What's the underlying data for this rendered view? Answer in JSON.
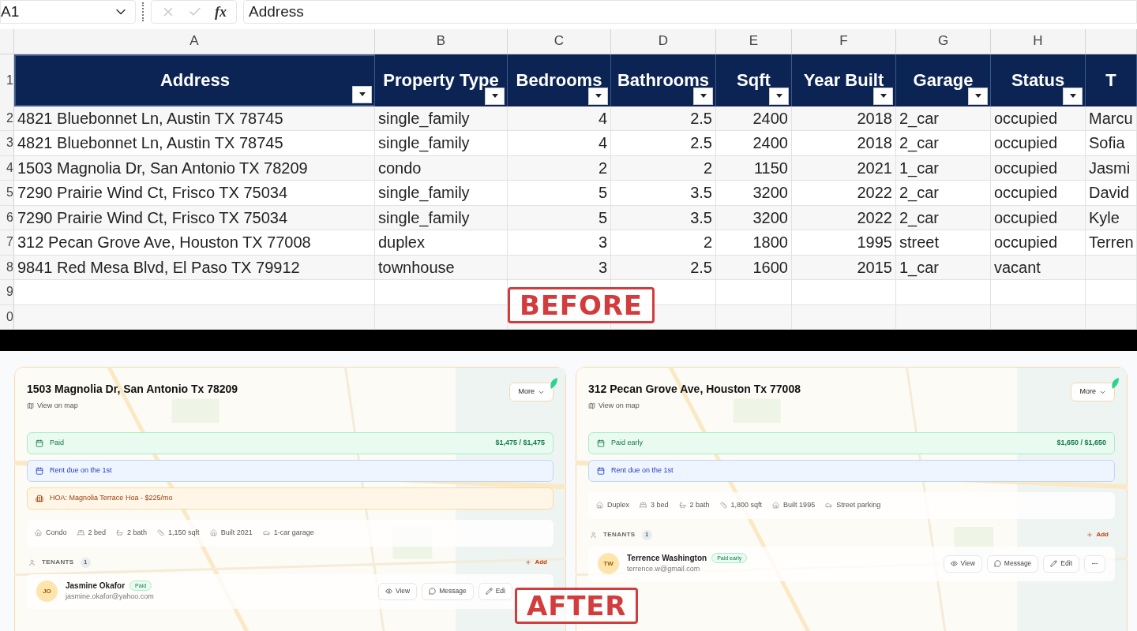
{
  "formula_bar": {
    "cell_ref": "A1",
    "function_label": "fx",
    "value": "Address"
  },
  "sheet": {
    "columns": [
      {
        "letter": "A",
        "header": "Address",
        "kind": "text"
      },
      {
        "letter": "B",
        "header": "Property Type",
        "kind": "text"
      },
      {
        "letter": "C",
        "header": "Bedrooms",
        "kind": "number"
      },
      {
        "letter": "D",
        "header": "Bathrooms",
        "kind": "number"
      },
      {
        "letter": "E",
        "header": "Sqft",
        "kind": "number"
      },
      {
        "letter": "F",
        "header": "Year Built",
        "kind": "number"
      },
      {
        "letter": "G",
        "header": "Garage",
        "kind": "text"
      },
      {
        "letter": "H",
        "header": "Status",
        "kind": "text"
      },
      {
        "header": "T",
        "kind": "text"
      }
    ],
    "header_row": "1",
    "rows": [
      {
        "number": "2",
        "cells": [
          "4821 Bluebonnet Ln, Austin TX 78745",
          "single_family",
          "4",
          "2.5",
          "2400",
          "2018",
          "2_car",
          "occupied",
          "Marcu"
        ]
      },
      {
        "number": "3",
        "cells": [
          "4821 Bluebonnet Ln, Austin TX 78745",
          "single_family",
          "4",
          "2.5",
          "2400",
          "2018",
          "2_car",
          "occupied",
          "Sofia"
        ]
      },
      {
        "number": "4",
        "cells": [
          "1503 Magnolia Dr, San Antonio TX 78209",
          "condo",
          "2",
          "2",
          "1150",
          "2021",
          "1_car",
          "occupied",
          "Jasmi"
        ]
      },
      {
        "number": "5",
        "cells": [
          "7290 Prairie Wind Ct, Frisco TX 75034",
          "single_family",
          "5",
          "3.5",
          "3200",
          "2022",
          "2_car",
          "occupied",
          "David"
        ]
      },
      {
        "number": "6",
        "cells": [
          "7290 Prairie Wind Ct, Frisco TX 75034",
          "single_family",
          "5",
          "3.5",
          "3200",
          "2022",
          "2_car",
          "occupied",
          "Kyle"
        ]
      },
      {
        "number": "7",
        "cells": [
          "312 Pecan Grove Ave, Houston TX 77008",
          "duplex",
          "3",
          "2",
          "1800",
          "1995",
          "street",
          "occupied",
          "Terren"
        ]
      },
      {
        "number": "8",
        "cells": [
          "9841 Red Mesa Blvd, El Paso TX 79912",
          "townhouse",
          "3",
          "2.5",
          "1600",
          "2015",
          "1_car",
          "vacant"
        ]
      },
      {
        "number": "9",
        "cells": []
      },
      {
        "number": "0",
        "cells": []
      }
    ]
  },
  "stamps": [
    {
      "kind": "before",
      "text": "BEFORE"
    },
    {
      "kind": "after",
      "text": "AFTER"
    }
  ],
  "cards": [
    {
      "address": "1503 Magnolia Dr, San Antonio Tx 78209",
      "map_link": "View on map",
      "more": "More",
      "payment": {
        "status": "Paid",
        "amount": "$1,475 / $1,475"
      },
      "notices": [
        {
          "kind": "rent",
          "text": "Rent due on the 1st"
        },
        {
          "kind": "hoa",
          "text": "HOA: Magnolia Terrace Hoa - $225/mo"
        }
      ],
      "features": [
        {
          "kind": "type",
          "text": "Condo"
        },
        {
          "kind": "bed",
          "text": "2 bed"
        },
        {
          "kind": "bath",
          "text": "2 bath"
        },
        {
          "kind": "sqft",
          "text": "1,150 sqft"
        },
        {
          "kind": "built",
          "text": "Built 2021"
        },
        {
          "kind": "garage",
          "text": "1-car garage"
        }
      ],
      "tenants_label": "TENANTS",
      "tenants_count": "1",
      "add": "Add",
      "tenants": [
        {
          "initials": "JO",
          "name": "Jasmine Okafor",
          "badge": "Paid",
          "email": "jasmine.okafor@yahoo.com",
          "actions": [
            {
              "kind": "view",
              "label": "View"
            },
            {
              "kind": "message",
              "label": "Message"
            },
            {
              "kind": "edit",
              "label": "Edi"
            }
          ]
        }
      ]
    },
    {
      "address": "312 Pecan Grove Ave, Houston Tx 77008",
      "map_link": "View on map",
      "more": "More",
      "payment": {
        "status": "Paid early",
        "amount": "$1,650 / $1,650"
      },
      "notices": [
        {
          "kind": "rent",
          "text": "Rent due on the 1st"
        }
      ],
      "features": [
        {
          "kind": "type",
          "text": "Duplex"
        },
        {
          "kind": "bed",
          "text": "3 bed"
        },
        {
          "kind": "bath",
          "text": "2 bath"
        },
        {
          "kind": "sqft",
          "text": "1,800 sqft"
        },
        {
          "kind": "built",
          "text": "Built 1995"
        },
        {
          "kind": "garage",
          "text": "Street parking"
        }
      ],
      "tenants_label": "TENANTS",
      "tenants_count": "1",
      "add": "Add",
      "tenants": [
        {
          "initials": "TW",
          "name": "Terrence Washington",
          "badge": "Paid early",
          "email": "terrence.w@gmail.com",
          "actions": [
            {
              "kind": "view",
              "label": "View"
            },
            {
              "kind": "message",
              "label": "Message"
            },
            {
              "kind": "edit",
              "label": "Edit"
            },
            {
              "kind": "more"
            }
          ]
        }
      ]
    }
  ]
}
